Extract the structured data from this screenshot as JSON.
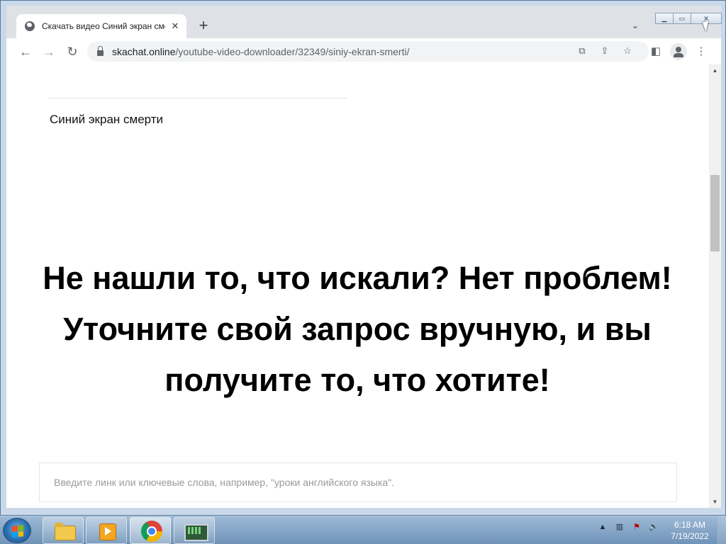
{
  "browser": {
    "tab": {
      "title": "Скачать видео Синий экран сме"
    },
    "url": {
      "host": "skachat.online",
      "path": "/youtube-video-downloader/32349/siniy-ekran-smerti/"
    }
  },
  "page": {
    "video_title": "Синий экран смерти",
    "headline_line1": "Не нашли то, что искали? Нет проблем!",
    "headline_line2": "Уточните свой запрос вручную, и вы получите то, что хотите!",
    "search": {
      "placeholder": "Введите линк или ключевые слова, например, \"уроки английского языка\"."
    }
  },
  "taskbar": {
    "time": "6:18 AM",
    "date": "7/19/2022"
  }
}
